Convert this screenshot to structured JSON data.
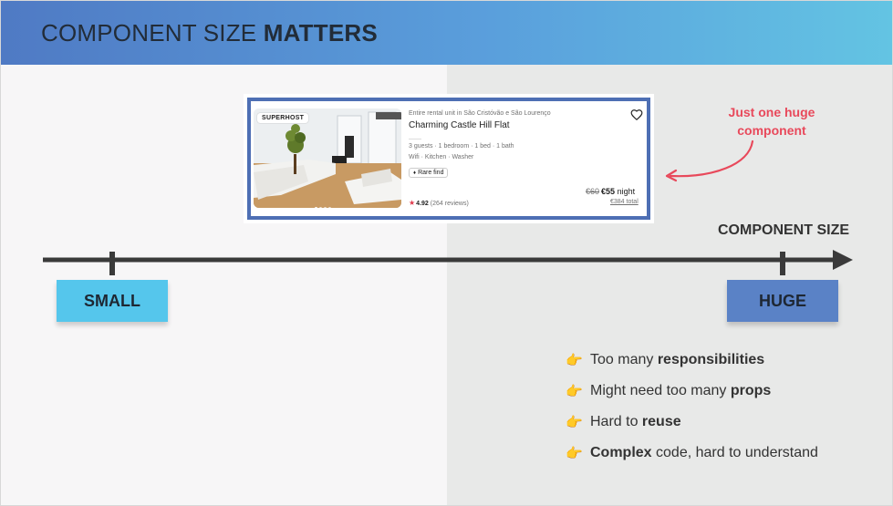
{
  "header": {
    "title_prefix": "COMPONENT SIZE ",
    "title_bold": "MATTERS"
  },
  "card": {
    "badge": "SUPERHOST",
    "subtitle": "Entire rental unit in São Cristóvão e São Lourenço",
    "title": "Charming Castle Hill Flat",
    "details": "3 guests · 1 bedroom · 1 bed · 1 bath",
    "amenities": "Wifi · Kitchen · Washer",
    "tag": "Rare find",
    "tag_icon": "gem-icon",
    "price_old": "€60",
    "price_new": "€55",
    "price_unit": " night",
    "total": "€384 total",
    "rating": "4.92",
    "reviews": "(264 reviews)",
    "heart_icon": "heart-icon"
  },
  "annotation": {
    "line1": "Just one huge",
    "line2": "component",
    "color": "#e8495b"
  },
  "axis": {
    "label": "COMPONENT SIZE",
    "low": "SMALL",
    "high": "HUGE"
  },
  "colors": {
    "small": "#55c6ec",
    "huge": "#5a82c6",
    "card_border": "#4e6fb4"
  },
  "bullets": [
    {
      "pre": "Too many ",
      "bold": "responsibilities",
      "post": ""
    },
    {
      "pre": "Might need too many ",
      "bold": "props",
      "post": ""
    },
    {
      "pre": "Hard to ",
      "bold": "reuse",
      "post": ""
    },
    {
      "pre": "",
      "bold": "Complex",
      "post": " code, hard to understand"
    }
  ],
  "bullet_icon": "pointing-hand-icon"
}
